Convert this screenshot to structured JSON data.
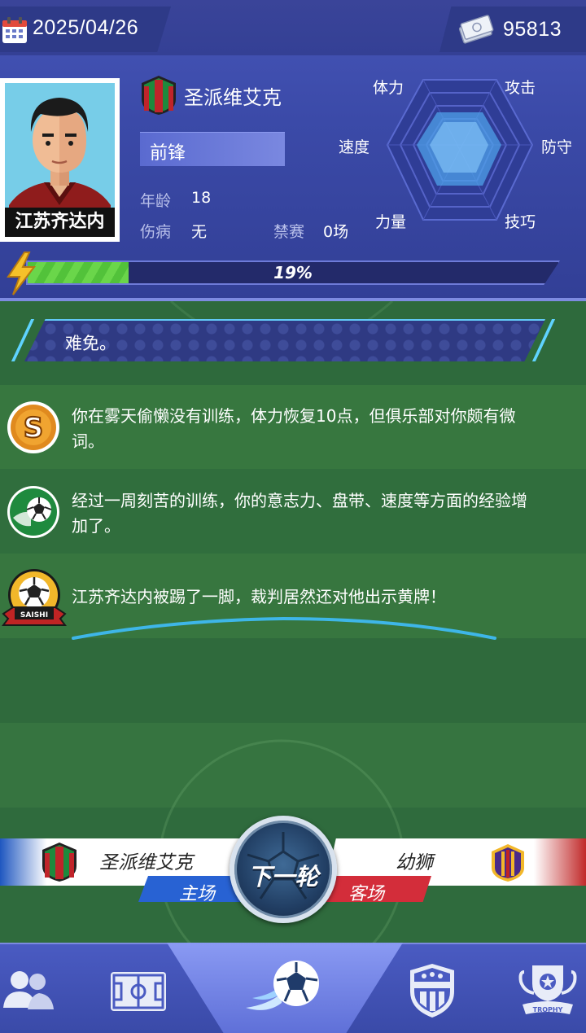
{
  "header": {
    "date": "2025/04/26",
    "money": "95813"
  },
  "player": {
    "name": "江苏齐达内",
    "team": "圣派维艾克",
    "position": "前锋",
    "age_label": "年龄",
    "age": "18",
    "injury_label": "伤病",
    "injury": "无",
    "suspension_label": "禁赛",
    "suspension": "0场"
  },
  "radar": {
    "stamina": "体力",
    "attack": "攻击",
    "speed": "速度",
    "defense": "防守",
    "strength": "力量",
    "skill": "技巧"
  },
  "energy": {
    "percent_text": "19%",
    "fraction": 0.19
  },
  "narrative": {
    "text": "难免。"
  },
  "events": [
    {
      "icon": "sponsor-s-icon",
      "text": "你在雾天偷懒没有训练，体力恢复10点，但俱乐部对你颇有微词。"
    },
    {
      "icon": "training-ball-icon",
      "text": "经过一周刻苦的训练，你的意志力、盘带、速度等方面的经验增加了。"
    },
    {
      "icon": "saishi-ball-icon",
      "text": "江苏齐达内被踢了一脚，裁判居然还对他出示黄牌！",
      "badge": "SAISHI"
    }
  ],
  "match": {
    "home_team": "圣派维艾克",
    "home_tag": "主场",
    "away_team": "幼狮",
    "away_tag": "客场",
    "next_label": "下一轮"
  },
  "nav": {
    "items": [
      "players-icon",
      "pitch-icon",
      "match-ball-icon",
      "club-shield-icon",
      "trophy-icon"
    ],
    "trophy_text": "TROPHY"
  },
  "colors": {
    "accent_blue": "#3b4aa8",
    "energy_green": "#52c23a",
    "home_blue": "#2862d3",
    "away_red": "#d32d3a"
  }
}
